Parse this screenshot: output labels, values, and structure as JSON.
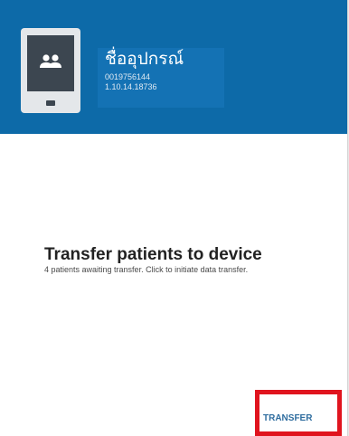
{
  "header": {
    "device_name": "ชื่ออุปกรณ์",
    "device_serial": "0019756144",
    "device_version": "1.10.14.18736",
    "device_icon": "tablet-with-people-icon"
  },
  "main": {
    "title": "Transfer patients to device",
    "description": "4 patients awaiting transfer. Click to initiate data transfer."
  },
  "actions": {
    "transfer_label": "TRANSFER"
  },
  "colors": {
    "header_background": "#0d6aa8",
    "highlight": "#e0141e",
    "action_text": "#2f6d9f"
  }
}
